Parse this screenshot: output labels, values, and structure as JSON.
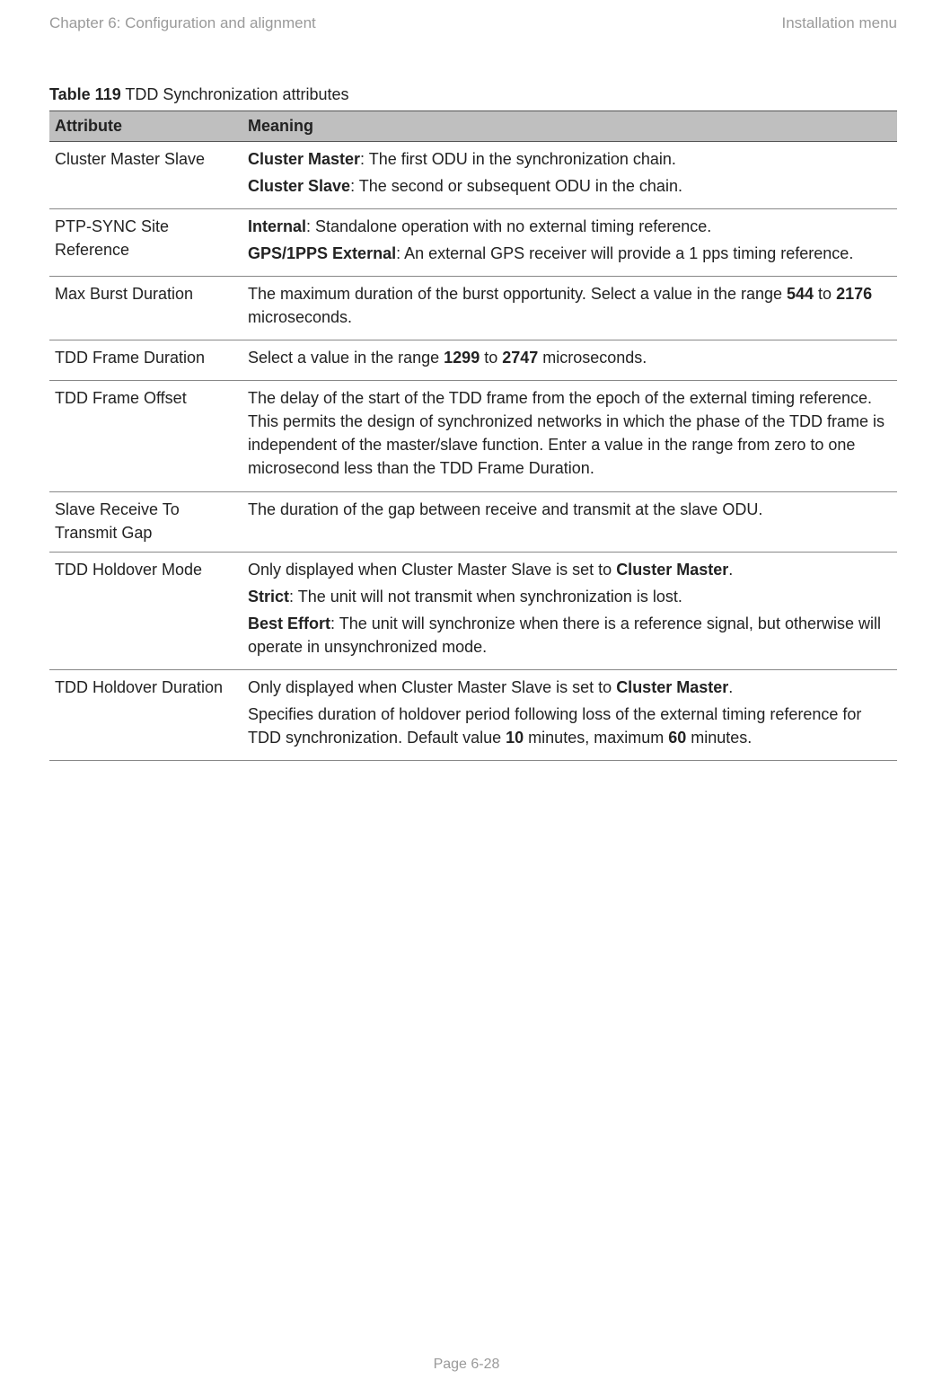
{
  "header": {
    "left": "Chapter 6:  Configuration and alignment",
    "right": "Installation menu"
  },
  "caption": {
    "label": "Table 119",
    "title": "  TDD Synchronization attributes"
  },
  "columns": {
    "attr": "Attribute",
    "mean": "Meaning"
  },
  "rows": {
    "r0": {
      "attr": "Cluster Master Slave",
      "p1a": "Cluster Master",
      "p1b": ": The first ODU in the synchronization chain.",
      "p2a": "Cluster Slave",
      "p2b": ": The second or subsequent ODU in the chain."
    },
    "r1": {
      "attr": "PTP-SYNC Site Reference",
      "p1a": "Internal",
      "p1b": ": Standalone operation with no external timing reference.",
      "p2a": "GPS/1PPS External",
      "p2b": ": An external GPS receiver will provide a 1 pps timing reference."
    },
    "r2": {
      "attr": "Max Burst Duration",
      "t1": "The maximum duration of the burst opportunity. Select a value in the range ",
      "b1": "544",
      "t2": " to ",
      "b2": "2176",
      "t3": " microseconds."
    },
    "r3": {
      "attr": "TDD Frame Duration",
      "t1": "Select a value in the range ",
      "b1": "1299",
      "t2": " to ",
      "b2": "2747",
      "t3": " microseconds."
    },
    "r4": {
      "attr": "TDD Frame Offset",
      "t1": "The delay of the start of the TDD frame from the epoch of the external timing reference. This permits the design of synchronized networks in which the phase of the TDD frame is independent of the master/slave function. Enter a value in the range from zero to one microsecond less than the TDD Frame Duration."
    },
    "r5": {
      "attr": "Slave Receive To Transmit Gap",
      "t1": "The duration of the gap between receive and transmit at the slave ODU."
    },
    "r6": {
      "attr": "TDD Holdover Mode",
      "p1a": "Only displayed when Cluster Master Slave is set to ",
      "p1b": "Cluster Master",
      "p1c": ".",
      "p2a": "Strict",
      "p2b": ": The unit will not transmit when synchronization is lost.",
      "p3a": "Best Effort",
      "p3b": ": The unit will synchronize when there is a reference signal, but otherwise will operate in unsynchronized mode."
    },
    "r7": {
      "attr": "TDD Holdover Duration",
      "p1a": "Only displayed when Cluster Master Slave is set to ",
      "p1b": "Cluster Master",
      "p1c": ".",
      "p2a": "Specifies duration of holdover period following loss of the external timing reference for TDD synchronization. Default value ",
      "p2b": "10",
      "p2c": " minutes, maximum ",
      "p2d": "60",
      "p2e": " minutes."
    }
  },
  "footer": "Page 6-28"
}
